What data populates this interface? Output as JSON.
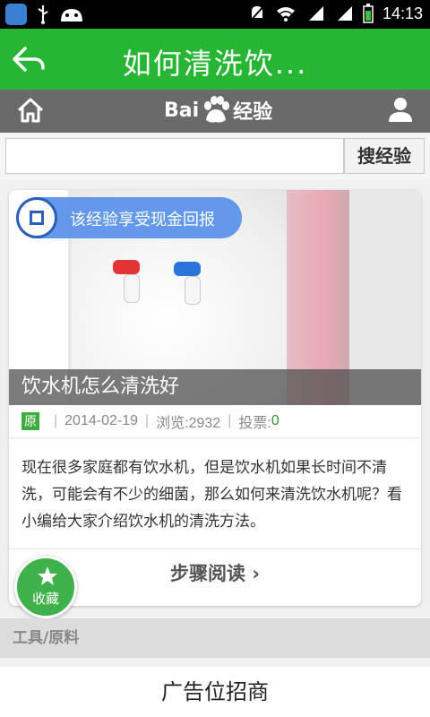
{
  "status_bar": {
    "time": "14:13",
    "icons": [
      "weather-app-icon",
      "usb-icon",
      "android-icon",
      "mute-icon",
      "wifi-icon",
      "signal-icon",
      "signal-icon-2",
      "battery-icon"
    ]
  },
  "title_bar": {
    "title": "如何清洗饮...",
    "back_icon": "back-arrow-icon"
  },
  "baidu_bar": {
    "logo_text_left": "Bai",
    "logo_text_right": "经验",
    "home_icon": "home-icon",
    "user_icon": "user-icon"
  },
  "search": {
    "value": "",
    "button_label": "搜经验"
  },
  "article": {
    "badge_text": "该经验享受现金回报",
    "title": "饮水机怎么清洗好",
    "original_tag": "原",
    "date": "2014-02-19",
    "views_label": "浏览:2932",
    "votes_label": "投票:",
    "votes_value": "0",
    "description": "现在很多家庭都有饮水机，但是饮水机如果长时间不清洗，可能会有不少的细菌，那么如何来清洗饮水机呢？看小编给大家介绍饮水机的清洗方法。",
    "steps_label": "步骤阅读 ›"
  },
  "favorite": {
    "label": "收藏",
    "icon": "star-icon"
  },
  "tools_section": {
    "label": "工具/原料"
  },
  "ad": {
    "label": "广告位招商"
  },
  "colors": {
    "title_green": "#27b534",
    "baidu_gray": "#6a6a6a",
    "badge_blue": "#5b92e9",
    "fav_green": "#3fb14a"
  }
}
